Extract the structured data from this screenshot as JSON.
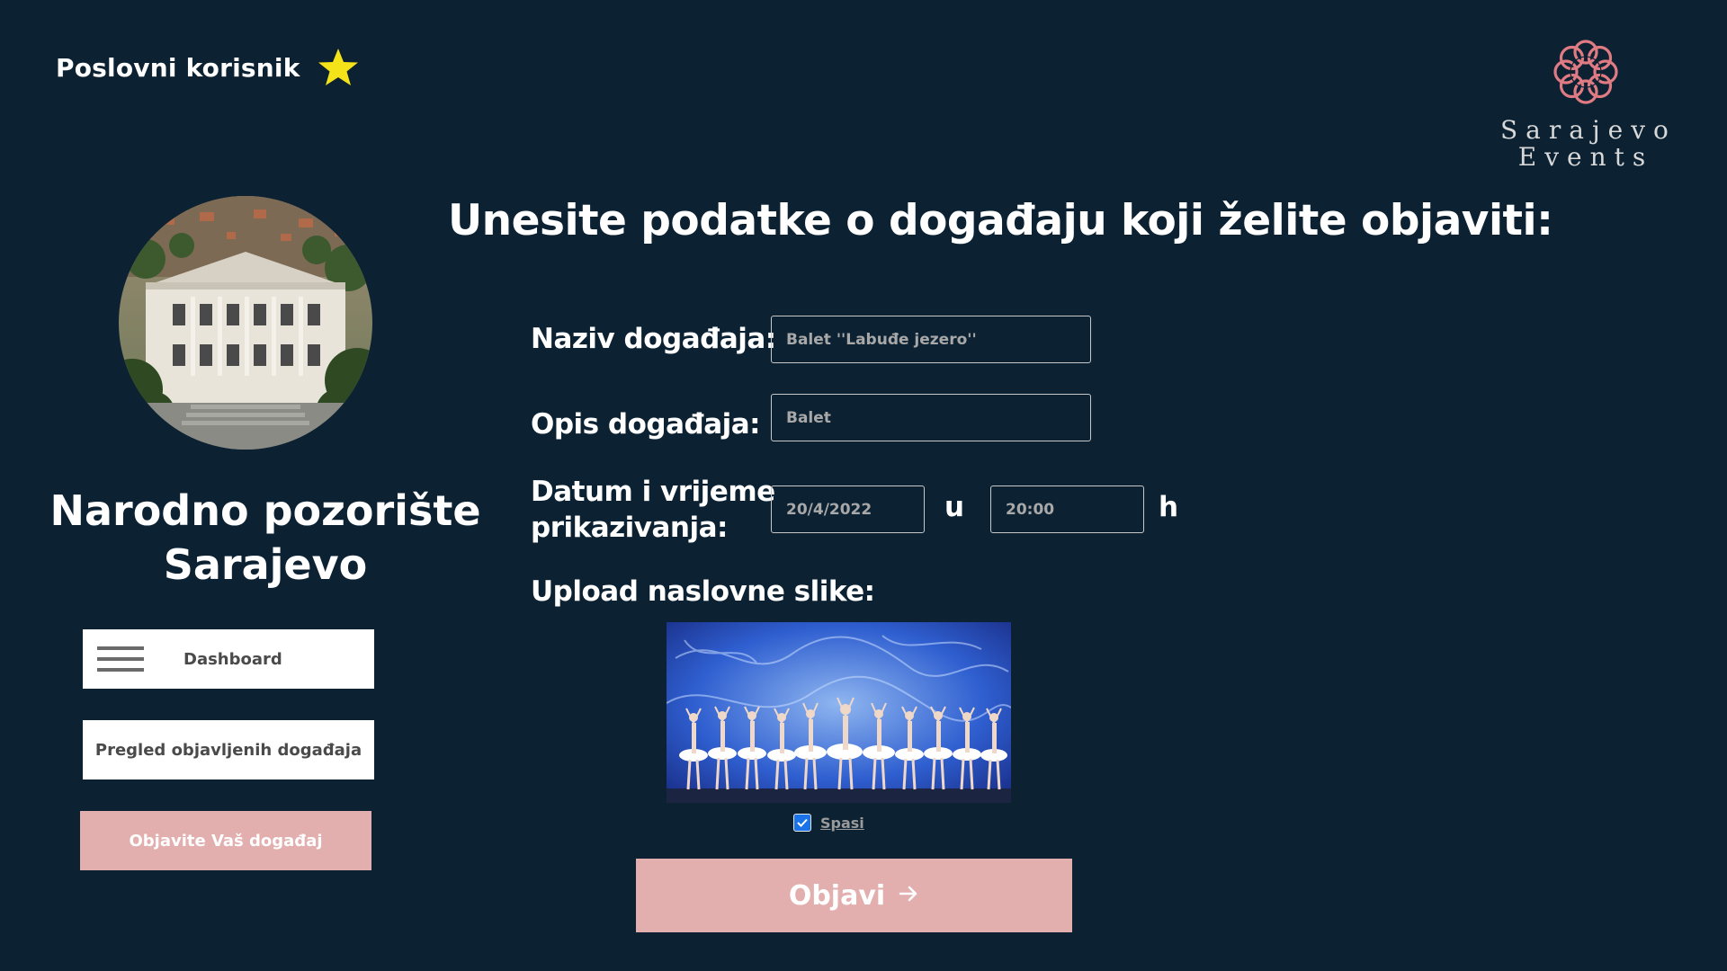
{
  "header": {
    "user_type": "Poslovni korisnik",
    "star_icon": "star-icon",
    "logo": {
      "line1": "Sarajevo",
      "line2": "Events",
      "icon": "knot-logo-icon",
      "color": "#e07b84"
    }
  },
  "profile": {
    "org_name": "Narodno pozorište Sarajevo",
    "avatar_icon": "theatre-building-photo"
  },
  "sidebar": {
    "items": [
      {
        "label": "Dashboard",
        "icon": "menu-icon"
      },
      {
        "label": "Pregled objavljenih događaja"
      },
      {
        "label": "Objavite Vaš događaj",
        "active": true
      }
    ]
  },
  "form": {
    "title": "Unesite podatke o događaju koji želite objaviti:",
    "name_label": "Naziv događaja:",
    "name_placeholder": "Balet ''Labuđe jezero''",
    "desc_label": "Opis događaja:",
    "desc_placeholder": "Balet",
    "datetime_label_line1": "Datum i vrijeme",
    "datetime_label_line2": "prikazivanja:",
    "date_placeholder": "20/4/2022",
    "time_placeholder": "20:00",
    "sep_u": "u",
    "sep_h": "h",
    "upload_label": "Upload naslovne slike:",
    "upload_image": "ballet-swan-lake-photo",
    "save_checked": true,
    "save_label": "Spasi",
    "submit_label": "Objavi",
    "submit_icon": "arrow-right-icon"
  },
  "colors": {
    "background": "#0c2233",
    "accent_pink": "#e2aeae",
    "checkbox_blue": "#1a73e8",
    "star": "#f5e31a"
  }
}
